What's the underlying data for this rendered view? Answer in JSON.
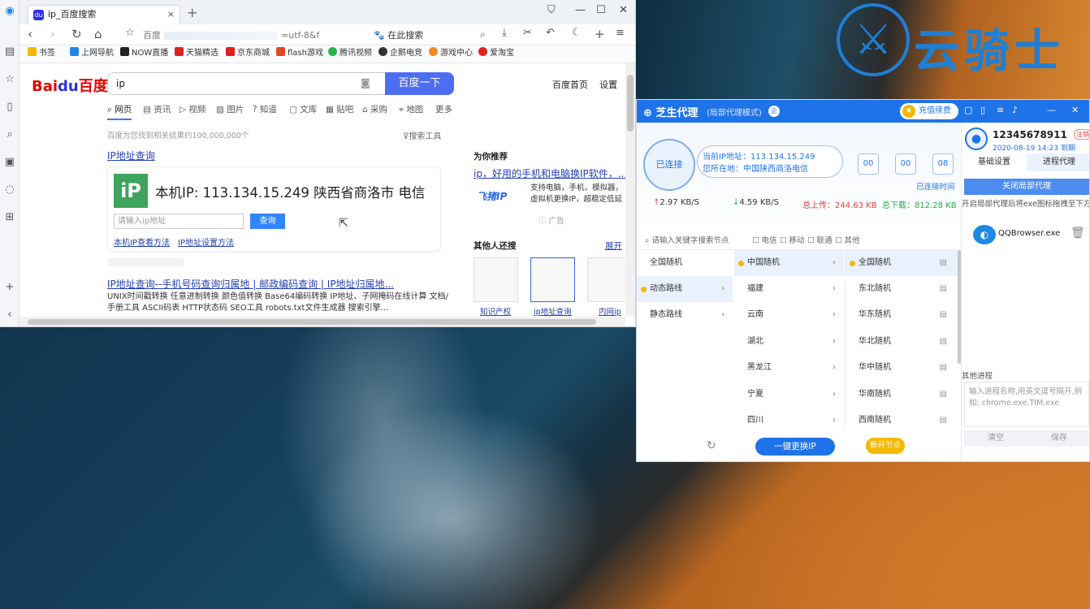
{
  "brand": {
    "name": "云骑士"
  },
  "browser": {
    "tab_title": "ip_百度搜索",
    "address_text": "百度",
    "address_tail": "=utf-8&f",
    "search_engine_label": "在此搜索",
    "bookmarks": [
      "书签",
      "上网导航",
      "NOW直播",
      "天猫精选",
      "京东商城",
      "flash游戏",
      "腾讯视频",
      "企鹅电竞",
      "游戏中心",
      "爱淘宝"
    ],
    "baidu": {
      "logo_a": "Bai",
      "logo_b": "du",
      "logo_c": "百度",
      "query": "ip",
      "search_button": "百度一下",
      "homepage_link": "百度首页",
      "settings_link": "设置",
      "tabs": [
        "网页",
        "资讯",
        "视频",
        "图片",
        "知道",
        "文库",
        "贴吧",
        "采购",
        "地图",
        "更多"
      ],
      "result_count": "百度为您找到相关结果约100,000,000个",
      "search_tools": "搜索工具",
      "result1_title": "IP地址查询",
      "ip_card": {
        "logo": "iP",
        "main": "本机IP: 113.134.15.249  陕西省商洛市 电信",
        "input_placeholder": "请输入ip地址",
        "query_button": "查询",
        "link1": "本机IP查看方法",
        "link2": "IP地址设置方法"
      },
      "result2_title": "IP地址查询--手机号码查询归属地 | 邮政编码查询 | IP地址归属地...",
      "result2_desc": "UNIX时间戳转换 任意进制转换 颜色值转换 Base64编码转换 IP地址、子网掩码在线计算 文档/手册工具 ASCII码表 HTTP状态码 SEO工具 robots.txt文件生成器 搜索引擎...",
      "recommend": {
        "heading": "为你推荐",
        "title": "ip，好用的手机和电脑换IP软件，...",
        "logo": "飞猪IP",
        "desc": "支持电脑，手机，模拟器，虚拟机更换IP，超稳定低延",
        "ad": "广告"
      },
      "others": {
        "heading": "其他人还搜",
        "expand": "展开",
        "items": [
          "知识产权",
          "ip地址查询",
          "内网ip"
        ]
      }
    }
  },
  "proxy": {
    "logo": "芝生代理",
    "mode": "(局部代理模式)",
    "badge": "企",
    "recharge": "充值续费",
    "connected": "已连接",
    "current_ip": "当前IP地址：113.134.15.249",
    "location": "您所在地：中国陕西商洛电信",
    "timer": [
      "00",
      "00",
      "08"
    ],
    "since_label": "已连接时间",
    "up_speed": "2.97 KB/S",
    "down_speed": "4.59 KB/S",
    "total_up": "总上传：244.63 KB",
    "total_down": "总下载：812.28 KB",
    "filter_placeholder": "请输入关键字搜索节点",
    "isp_filters": [
      "电信",
      "移动",
      "联通",
      "其他"
    ],
    "categories": [
      "全国随机",
      "动态路线",
      "静态路线"
    ],
    "provinces": [
      "中国随机",
      "福建",
      "云南",
      "湖北",
      "黑龙江",
      "宁夏",
      "四川"
    ],
    "regions": [
      "全国随机",
      "东北随机",
      "华东随机",
      "华北随机",
      "华中随机",
      "华南随机",
      "西南随机"
    ],
    "change_ip_button": "一键更换IP",
    "new_node_button": "新开节点",
    "user": {
      "id": "12345678911",
      "logout": "注销",
      "expire": "2020-08-19 14:23 到期"
    },
    "side_tabs": [
      "基础设置",
      "进程代理"
    ],
    "close_proxy_button": "关闭局部代理",
    "tip": "开启局部代理后将exe图标拖拽至下方",
    "process": "QQBrowser.exe",
    "other_process_label": "其他进程",
    "other_process_placeholder": "输入进程名称,用英文逗号隔开,例如: chrome.exe,TIM.exe",
    "clear_button": "清空",
    "save_button": "保存"
  }
}
